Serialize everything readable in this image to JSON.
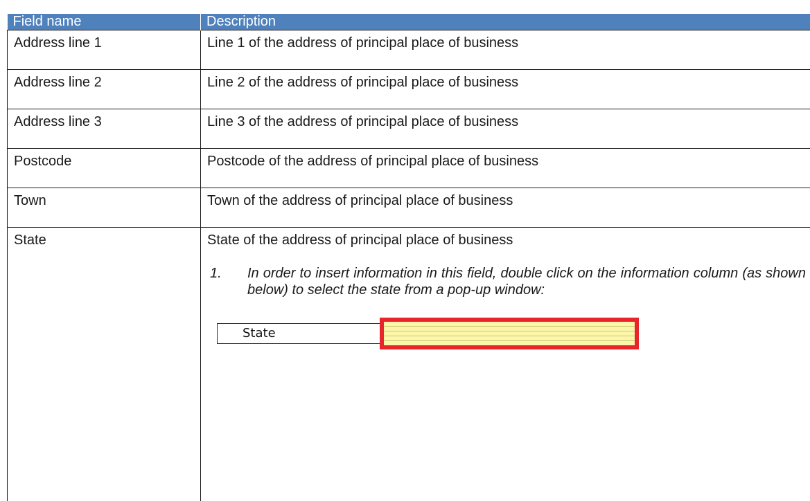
{
  "table": {
    "headers": [
      "Field name",
      "Description"
    ],
    "rows": [
      {
        "field": "Address line 1",
        "description": "Line 1 of the address of principal place of business"
      },
      {
        "field": "Address line 2",
        "description": "Line 2 of the address of principal place of business"
      },
      {
        "field": "Address line 3",
        "description": "Line 3 of the address of principal place of business"
      },
      {
        "field": "Postcode",
        "description": "Postcode of the address of principal place of business"
      },
      {
        "field": "Town",
        "description": "Town of the address of principal place of business"
      },
      {
        "field": "State",
        "description": "State of the address of principal place of business"
      }
    ]
  },
  "note": {
    "number": "1.",
    "text": "In order to insert information in this field, double click on the information column (as shown below) to select the state from a pop-up window:"
  },
  "widget": {
    "label": "State",
    "field_value": "",
    "highlight_color": "#e8242c",
    "field_color": "#fbf6a8"
  },
  "colors": {
    "header_bg": "#4f81bd",
    "header_text": "#ffffff"
  }
}
